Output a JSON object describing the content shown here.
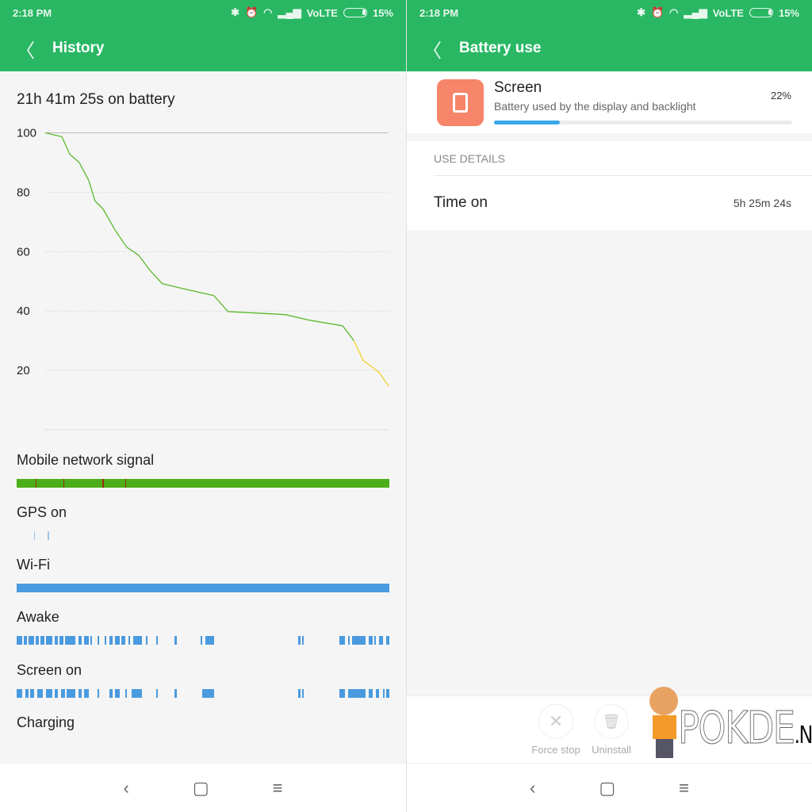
{
  "status": {
    "time": "2:18 PM",
    "network": "VoLTE",
    "battery": "15%",
    "icons": [
      "bluetooth-icon",
      "alarm-icon",
      "wifi-icon",
      "signal-icon",
      "battery-icon"
    ]
  },
  "history": {
    "title": "History",
    "on_battery": "21h 41m 25s on battery",
    "chart_data": {
      "type": "line",
      "y_ticks": [
        "100",
        "80",
        "60",
        "40",
        "20"
      ],
      "ylim": [
        0,
        100
      ],
      "xlim_hours": [
        0,
        21.69
      ],
      "grid": true,
      "x_hours": [
        0,
        1.05,
        1.55,
        2.15,
        2.75,
        3.15,
        3.65,
        4.4,
        5.15,
        5.9,
        6.65,
        7.4,
        8.65,
        10.65,
        11.55,
        15.15,
        16.6,
        18.8,
        19.5,
        20.1,
        21.1,
        21.69
      ],
      "battery_percent": [
        100,
        98.7,
        92.8,
        90,
        84,
        77,
        74.4,
        67.4,
        61.5,
        58.8,
        53.5,
        49.2,
        47.6,
        45.2,
        39.8,
        38.8,
        37,
        35,
        30,
        23.3,
        19.3,
        14.7
      ],
      "colors": {
        "normal": "#5cb82e",
        "low": "#f2d024"
      }
    },
    "tracks": [
      {
        "label": "Mobile network signal",
        "color": "#4caf1a",
        "full": true,
        "marks": [
          1.1,
          2.7,
          5,
          6.3
        ],
        "mark_color": "#9c2b12"
      },
      {
        "label": "GPS on",
        "color": "#9cc6ee",
        "segments": [
          [
            1.0,
            1.05
          ],
          [
            1.8,
            1.85
          ]
        ]
      },
      {
        "label": "Wi-Fi",
        "color": "#4a9ae0",
        "full": true
      },
      {
        "label": "Awake",
        "color": "#4a9ae0",
        "segments": [
          [
            0,
            0.3
          ],
          [
            0.4,
            0.6
          ],
          [
            0.7,
            1.0
          ],
          [
            1.1,
            1.3
          ],
          [
            1.4,
            1.6
          ],
          [
            1.7,
            2.1
          ],
          [
            2.2,
            2.4
          ],
          [
            2.5,
            2.7
          ],
          [
            2.8,
            3.4
          ],
          [
            3.6,
            3.8
          ],
          [
            3.9,
            4.2
          ],
          [
            4.3,
            4.4
          ],
          [
            4.7,
            4.8
          ],
          [
            5.1,
            5.2
          ],
          [
            5.4,
            5.6
          ],
          [
            5.7,
            6.0
          ],
          [
            6.1,
            6.3
          ],
          [
            6.5,
            6.6
          ],
          [
            6.8,
            7.3
          ],
          [
            7.5,
            7.6
          ],
          [
            8.1,
            8.2
          ],
          [
            9.2,
            9.3
          ],
          [
            10.7,
            10.8
          ],
          [
            11.0,
            11.5
          ],
          [
            16.4,
            16.5
          ],
          [
            16.6,
            16.7
          ],
          [
            18.8,
            19.1
          ],
          [
            19.3,
            19.4
          ],
          [
            19.5,
            20.3
          ],
          [
            20.5,
            20.7
          ],
          [
            20.8,
            20.9
          ],
          [
            21.1,
            21.3
          ],
          [
            21.5,
            21.69
          ]
        ]
      },
      {
        "label": "Screen on",
        "color": "#4a9ae0",
        "segments": [
          [
            0,
            0.3
          ],
          [
            0.5,
            0.7
          ],
          [
            0.8,
            1.0
          ],
          [
            1.2,
            1.5
          ],
          [
            1.7,
            2.1
          ],
          [
            2.2,
            2.4
          ],
          [
            2.6,
            2.8
          ],
          [
            2.9,
            3.4
          ],
          [
            3.6,
            3.8
          ],
          [
            3.9,
            4.2
          ],
          [
            4.7,
            4.8
          ],
          [
            5.4,
            5.6
          ],
          [
            5.7,
            6.0
          ],
          [
            6.3,
            6.4
          ],
          [
            6.7,
            7.3
          ],
          [
            8.1,
            8.2
          ],
          [
            9.2,
            9.3
          ],
          [
            10.8,
            11.5
          ],
          [
            16.4,
            16.5
          ],
          [
            16.6,
            16.7
          ],
          [
            18.8,
            19.1
          ],
          [
            19.3,
            20.3
          ],
          [
            20.5,
            20.7
          ],
          [
            20.9,
            21.1
          ],
          [
            21.3,
            21.4
          ],
          [
            21.5,
            21.69
          ]
        ]
      },
      {
        "label": "Charging",
        "color": "#4a9ae0",
        "segments": []
      }
    ]
  },
  "battery_use": {
    "title": "Battery use",
    "app_name": "Screen",
    "app_desc": "Battery used by the display and backlight",
    "percent": "22%",
    "usage_fraction": 0.22,
    "section": "USE DETAILS",
    "time_on_label": "Time on",
    "time_on_value": "5h 25m 24s",
    "actions": [
      {
        "label": "Force stop",
        "icon": "close-icon"
      },
      {
        "label": "Uninstall",
        "icon": "trash-icon"
      }
    ],
    "watermark": "POKDE.NET"
  }
}
